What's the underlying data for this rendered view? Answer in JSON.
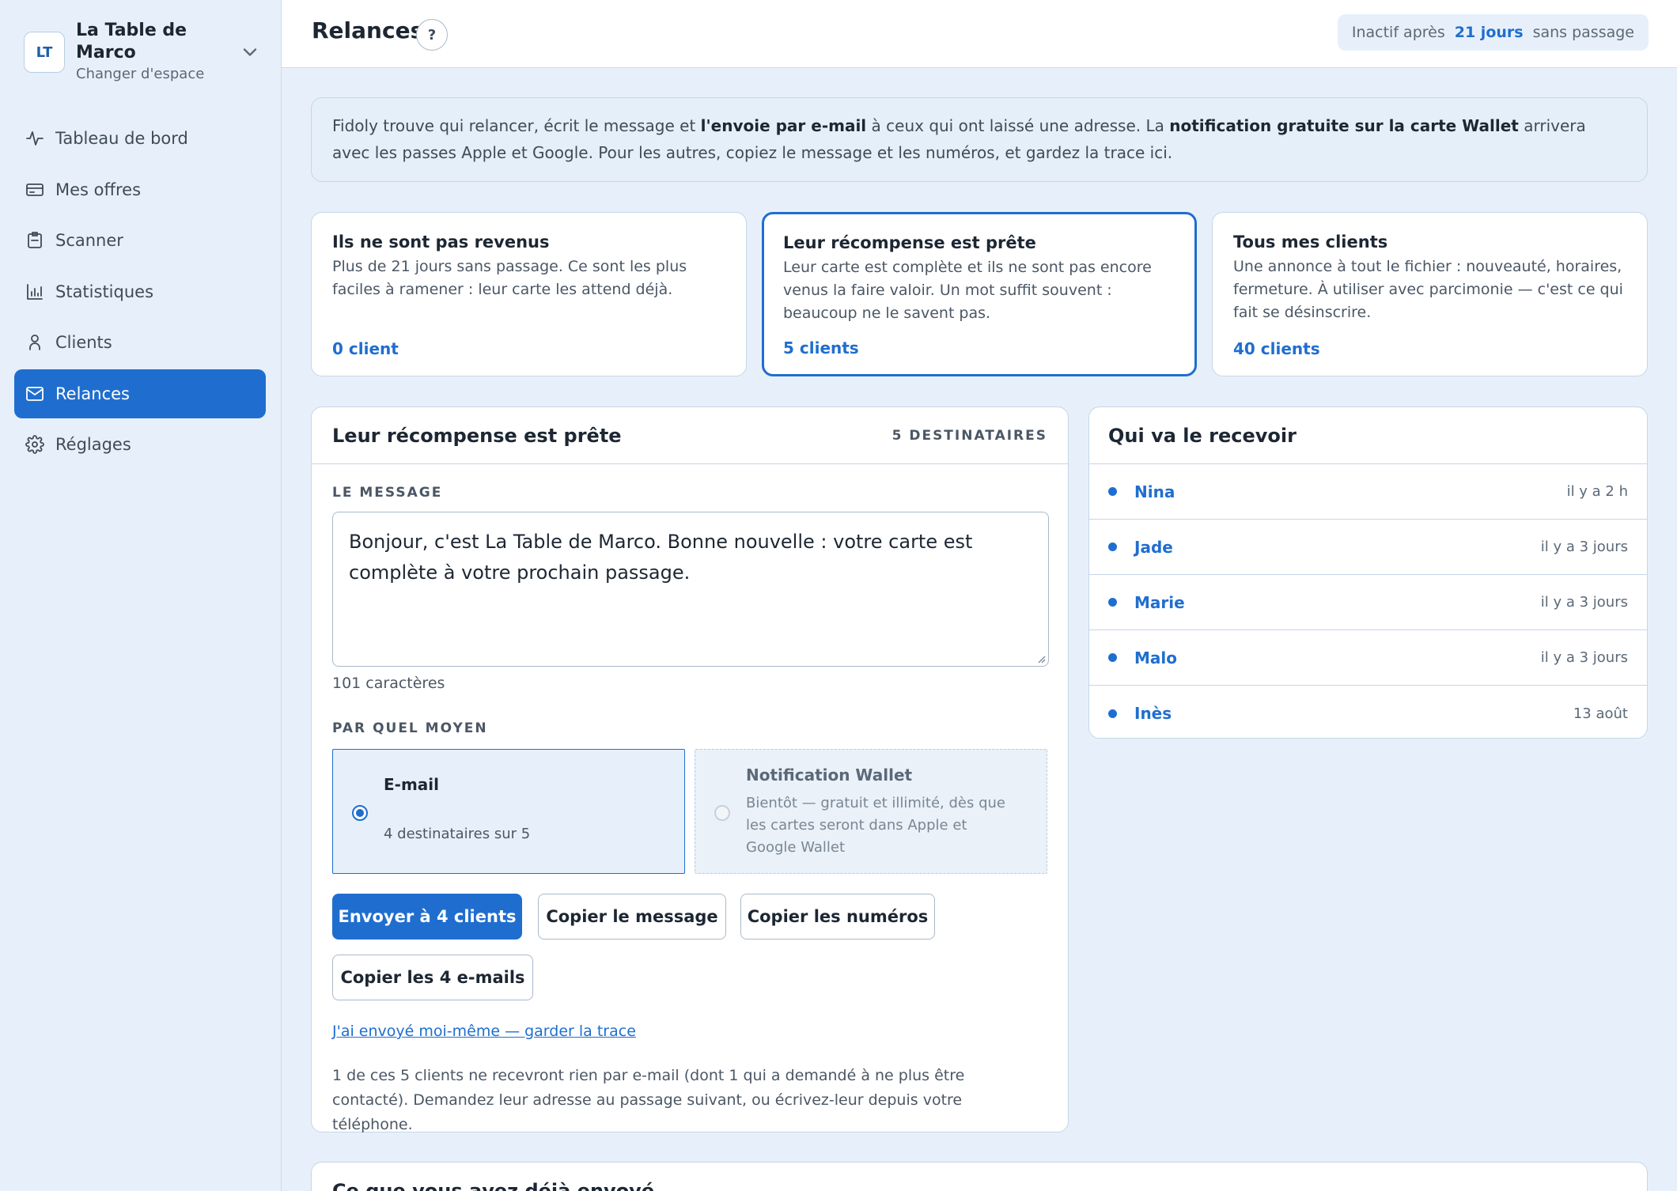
{
  "workspace": {
    "initials": "LT",
    "name": "La Table de Marco",
    "switch_label": "Changer d'espace"
  },
  "nav": [
    {
      "label": "Tableau de bord",
      "icon": "activity-icon",
      "active": false
    },
    {
      "label": "Mes offres",
      "icon": "card-icon",
      "active": false
    },
    {
      "label": "Scanner",
      "icon": "scanner-icon",
      "active": false
    },
    {
      "label": "Statistiques",
      "icon": "bar-chart-icon",
      "active": false
    },
    {
      "label": "Clients",
      "icon": "user-icon",
      "active": false
    },
    {
      "label": "Relances",
      "icon": "mail-icon",
      "active": true
    },
    {
      "label": "Réglages",
      "icon": "gear-icon",
      "active": false
    }
  ],
  "header": {
    "title": "Relances",
    "help": "?",
    "inactive_prefix": "Inactif après",
    "inactive_days": "21 jours",
    "inactive_suffix": "sans passage"
  },
  "info": {
    "t1": "Fidoly trouve qui relancer, écrit le message et ",
    "b1": "l'envoie par e-mail",
    "t2": " à ceux qui ont laissé une adresse. La ",
    "b2": "notification gratuite sur la carte Wallet",
    "t3": " arrivera avec les passes Apple et Google. Pour les autres, copiez le message et les numéros, et gardez la trace ici."
  },
  "segments": [
    {
      "title": "Ils ne sont pas revenus",
      "desc": "Plus de 21 jours sans passage. Ce sont les plus faciles à ramener : leur carte les attend déjà.",
      "count": "0 client",
      "selected": false
    },
    {
      "title": "Leur récompense est prête",
      "desc": "Leur carte est complète et ils ne sont pas encore venus la faire valoir. Un mot suffit souvent : beaucoup ne le savent pas.",
      "count": "5 clients",
      "selected": true
    },
    {
      "title": "Tous mes clients",
      "desc": "Une annonce à tout le fichier : nouveauté, horaires, fermeture. À utiliser avec parcimonie — c'est ce qui fait se désinscrire.",
      "count": "40 clients",
      "selected": false
    }
  ],
  "compose": {
    "title": "Leur récompense est prête",
    "recipients_label": "5 DESTINATAIRES",
    "message_label": "LE MESSAGE",
    "message": "Bonjour, c'est La Table de Marco. Bonne nouvelle : votre carte est complète à votre prochain passage.",
    "char_count": "101 caractères",
    "channel_label": "PAR QUEL MOYEN",
    "email_title": "E-mail",
    "email_sub": "4 destinataires sur 5",
    "wallet_title": "Notification Wallet",
    "wallet_sub": "Bientôt — gratuit et illimité, dès que les cartes seront dans Apple et Google Wallet",
    "send_btn": "Envoyer à 4 clients",
    "copy_msg_btn": "Copier le message",
    "copy_nums_btn": "Copier les numéros",
    "copy_emails_btn": "Copier les 4 e-mails",
    "self_sent_link": "J'ai envoyé moi-même — garder la trace",
    "note": "1 de ces 5 clients ne recevront rien par e-mail (dont 1 qui a demandé à ne plus être contacté). Demandez leur adresse au passage suivant, ou écrivez-leur depuis votre téléphone."
  },
  "recipients": {
    "title": "Qui va le recevoir",
    "items": [
      {
        "name": "Nina",
        "time": "il y a 2 h"
      },
      {
        "name": "Jade",
        "time": "il y a 3 jours"
      },
      {
        "name": "Marie",
        "time": "il y a 3 jours"
      },
      {
        "name": "Malo",
        "time": "il y a 3 jours"
      },
      {
        "name": "Inès",
        "time": "13 août"
      }
    ]
  },
  "history": {
    "title": "Ce que vous avez déjà envoyé"
  },
  "colors": {
    "accent": "#1f6ecf",
    "background": "#e7f0fa",
    "card": "#ffffff",
    "border": "#c5d6e7"
  }
}
